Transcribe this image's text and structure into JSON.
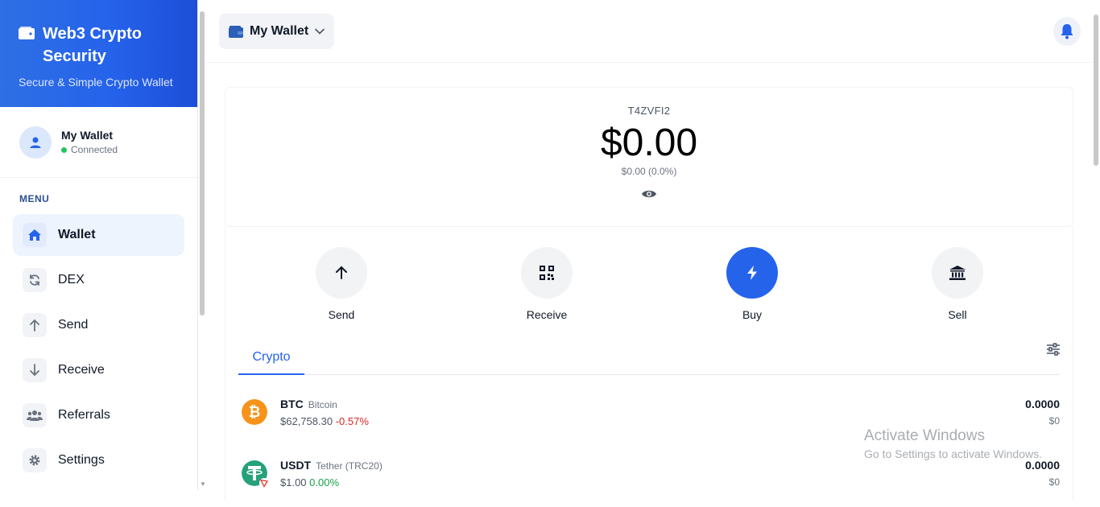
{
  "brand": {
    "title": "Web3 Crypto Security",
    "subtitle": "Secure & Simple Crypto Wallet"
  },
  "profile": {
    "name": "My Wallet",
    "status": "Connected"
  },
  "menu": {
    "title": "MENU",
    "items": [
      {
        "label": "Wallet",
        "icon": "home-icon",
        "active": true
      },
      {
        "label": "DEX",
        "icon": "swap-icon"
      },
      {
        "label": "Send",
        "icon": "arrow-up-icon"
      },
      {
        "label": "Receive",
        "icon": "arrow-down-icon"
      },
      {
        "label": "Referrals",
        "icon": "users-icon"
      },
      {
        "label": "Settings",
        "icon": "gear-icon"
      }
    ]
  },
  "topbar": {
    "wallet_label": "My Wallet"
  },
  "balance": {
    "address": "T4ZVFI2",
    "amount": "$0.00",
    "change": "$0.00 (0.0%)"
  },
  "actions": [
    {
      "label": "Send",
      "icon": "arrow-up-icon"
    },
    {
      "label": "Receive",
      "icon": "qr-code-icon"
    },
    {
      "label": "Buy",
      "icon": "bolt-icon"
    },
    {
      "label": "Sell",
      "icon": "bank-icon"
    }
  ],
  "tabs": {
    "crypto": "Crypto"
  },
  "assets": [
    {
      "symbol": "BTC",
      "name": "Bitcoin",
      "price": "$62,758.30",
      "change": "-0.57%",
      "amount": "0.0000",
      "value": "$0"
    },
    {
      "symbol": "USDT",
      "name": "Tether (TRC20)",
      "price": "$1.00",
      "change": "0.00%",
      "amount": "0.0000",
      "value": "$0"
    }
  ],
  "watermark": {
    "line1": "Activate Windows",
    "line2": "Go to Settings to activate Windows."
  },
  "colors": {
    "accent": "#2563eb",
    "negative": "#dc2626",
    "positive": "#16a34a",
    "btc": "#f7931a",
    "usdt": "#26a17b"
  }
}
